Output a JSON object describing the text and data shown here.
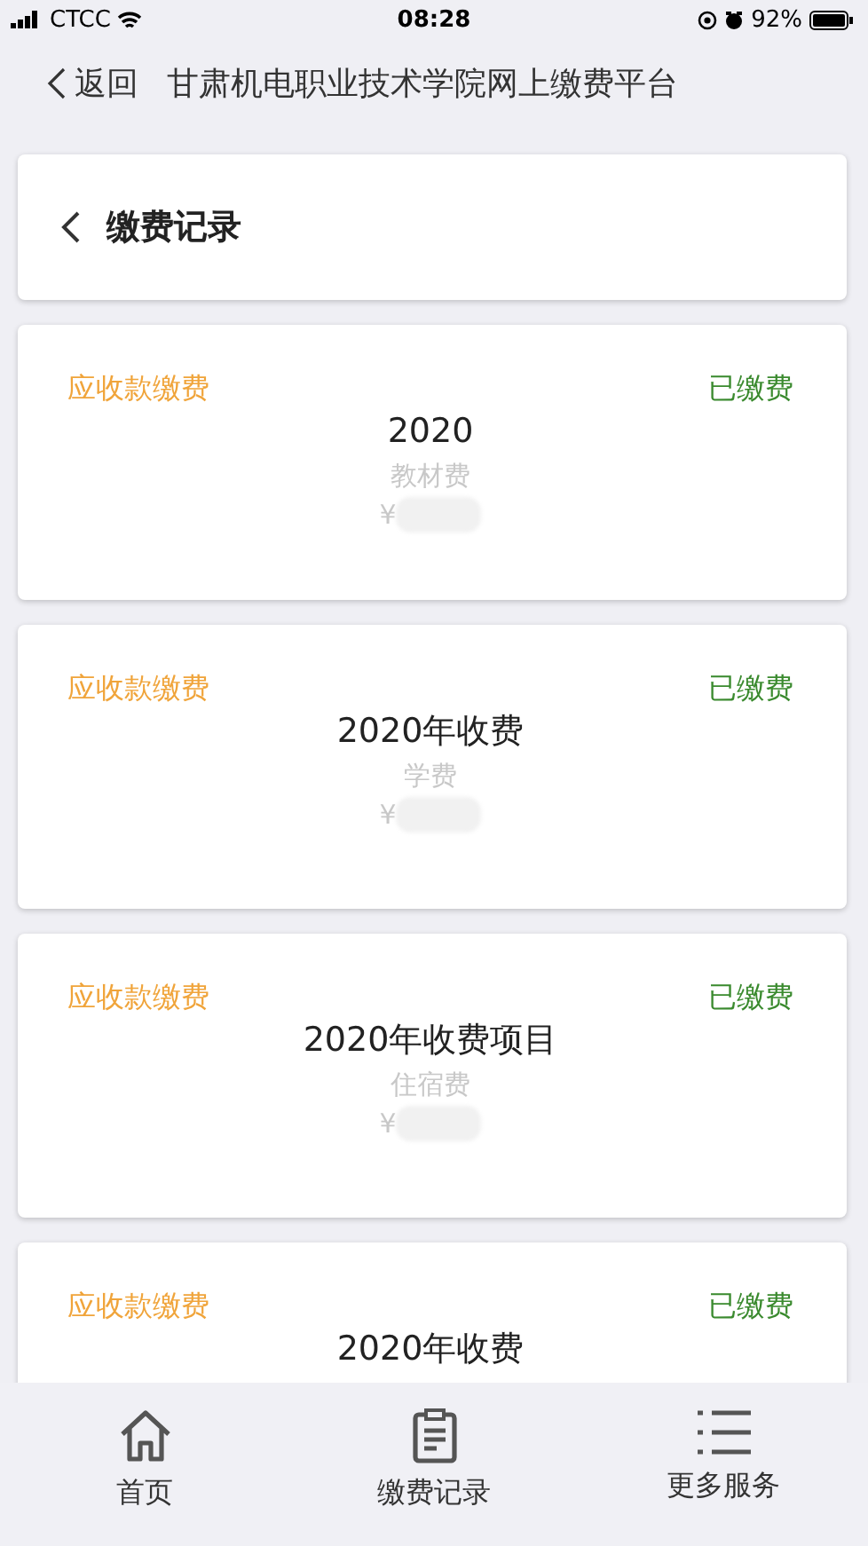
{
  "status_bar": {
    "carrier": "CTCC",
    "time": "08:28",
    "battery": "92%"
  },
  "nav_bar": {
    "back": "返回",
    "title": "甘肃机电职业技术学院网上缴费平台"
  },
  "header": {
    "title": "缴费记录"
  },
  "records": [
    {
      "type": "应收款缴费",
      "status": "已缴费",
      "title": "2020",
      "item": "教材费",
      "currency": "¥"
    },
    {
      "type": "应收款缴费",
      "status": "已缴费",
      "title": "2020年收费",
      "item": "学费",
      "currency": "¥"
    },
    {
      "type": "应收款缴费",
      "status": "已缴费",
      "title": "2020年收费项目",
      "item": "住宿费",
      "currency": "¥"
    },
    {
      "type": "应收款缴费",
      "status": "已缴费",
      "title": "2020年收费"
    }
  ],
  "tab_bar": [
    {
      "kind": "home",
      "label": "首页"
    },
    {
      "kind": "records",
      "label": "缴费记录"
    },
    {
      "kind": "list",
      "label": "更多服务"
    }
  ]
}
